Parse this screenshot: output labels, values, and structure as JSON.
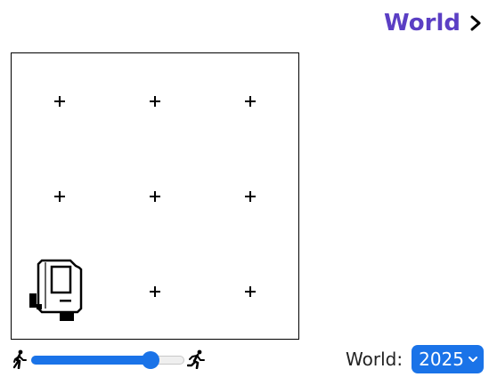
{
  "header": {
    "world_link_label": "World",
    "chevron_icon": "chevron-right-icon"
  },
  "canvas": {
    "grid_columns": 3,
    "grid_rows": 3,
    "markers": "plus",
    "robot_icon": "robot-icon",
    "robot_cell": {
      "column": 1,
      "row": 3
    }
  },
  "controls": {
    "speed_slow_icon": "walk-icon",
    "speed_fast_icon": "run-icon",
    "speed_value": 0.78,
    "world_label": "World:",
    "world_selected": "2025",
    "select_icon": "chevron-down-icon"
  },
  "colors": {
    "title": "#5b3fc4",
    "accent": "#1a73e8",
    "border": "#000000"
  }
}
